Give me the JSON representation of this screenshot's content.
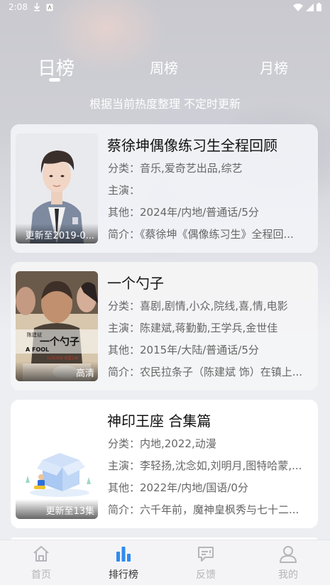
{
  "status_bar": {
    "time": "2:08",
    "icons": [
      "download-icon",
      "a-badge-icon",
      "wifi-icon",
      "signal-icon",
      "battery-icon"
    ]
  },
  "top_tabs": [
    {
      "label": "日榜",
      "active": true
    },
    {
      "label": "周榜",
      "active": false
    },
    {
      "label": "月榜",
      "active": false
    }
  ],
  "subtitle": "根据当前热度整理 不定时更新",
  "cards": [
    {
      "title": "蔡徐坤偶像练习生全程回顾",
      "badge": "更新至2019-0...",
      "category": "分类：音乐,爱奇艺出品,综艺",
      "cast": "主演：",
      "other": "其他：2024年/内地/普通话/5分",
      "intro": "简介：《蔡徐坤《偶像练习生》全程回..."
    },
    {
      "title": "一个勺子",
      "badge": "高清",
      "category": "分类：喜剧,剧情,小众,院线,喜,情,电影",
      "cast": "主演：陈建斌,蒋勤勤,王学兵,金世佳",
      "other": "其他：2015年/大陆/普通话/5分",
      "intro": "简介：农民拉条子（陈建斌 饰）在镇上..."
    },
    {
      "title": "神印王座 合集篇",
      "badge": "更新至13集",
      "category": "分类：内地,2022,动漫",
      "cast": "主演：李轻扬,沈念如,刘明月,图特哈蒙,...",
      "other": "其他：2022年/内地/国语/0分",
      "intro": "简介：六千年前，魔神皇枫秀与七十二..."
    }
  ],
  "poster2_text": {
    "director": "陈建斌",
    "title_cn": "一个勺子",
    "title_en": "A FOOL",
    "release": "11月20日 全国上映"
  },
  "nav": [
    {
      "label": "首页",
      "icon": "home-icon",
      "active": false
    },
    {
      "label": "排行榜",
      "icon": "ranking-icon",
      "active": true
    },
    {
      "label": "反馈",
      "icon": "feedback-icon",
      "active": false
    },
    {
      "label": "我的",
      "icon": "profile-icon",
      "active": false
    }
  ],
  "colors": {
    "accent": "#2f8cf0",
    "inactive": "#b5b5bb"
  }
}
